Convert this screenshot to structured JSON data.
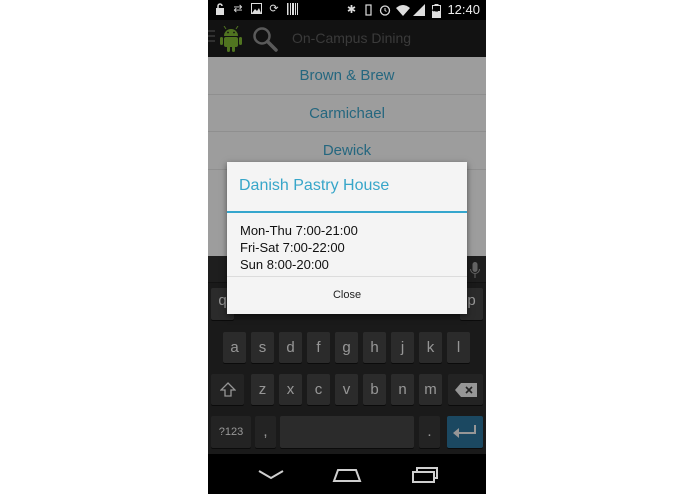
{
  "status_bar": {
    "time": "12:40",
    "battery_level": "43",
    "icons": [
      "lock-icon",
      "sync-icon",
      "image-icon",
      "refresh-icon",
      "barcode-icon",
      "bluetooth-icon",
      "vibrate-icon",
      "alarm-icon",
      "wifi-icon",
      "signal-icon",
      "battery-icon"
    ]
  },
  "action_bar": {
    "title": "On-Campus Dining",
    "icons": [
      "menu-icon",
      "android-logo-icon",
      "search-icon"
    ]
  },
  "list": {
    "items": [
      "Brown & Brew",
      "Carmichael",
      "Dewick"
    ]
  },
  "dialog": {
    "title": "Danish Pastry House",
    "hours": [
      "Mon-Thu 7:00-21:00",
      "Fri-Sat 7:00-22:00",
      "Sun 8:00-20:00"
    ],
    "close_label": "Close"
  },
  "keyboard": {
    "row1_visible": [
      "q",
      "p"
    ],
    "row2": [
      "a",
      "s",
      "d",
      "f",
      "g",
      "h",
      "j",
      "k",
      "l"
    ],
    "row3": [
      "z",
      "x",
      "c",
      "v",
      "b",
      "n",
      "m"
    ],
    "symbols_label": "?123",
    "comma_label": ",",
    "period_label": ".",
    "icons": [
      "mic-icon",
      "shift-icon",
      "backspace-icon",
      "enter-icon"
    ]
  },
  "colors": {
    "accent": "#37a6c9",
    "enter_key": "#2a6f96"
  }
}
